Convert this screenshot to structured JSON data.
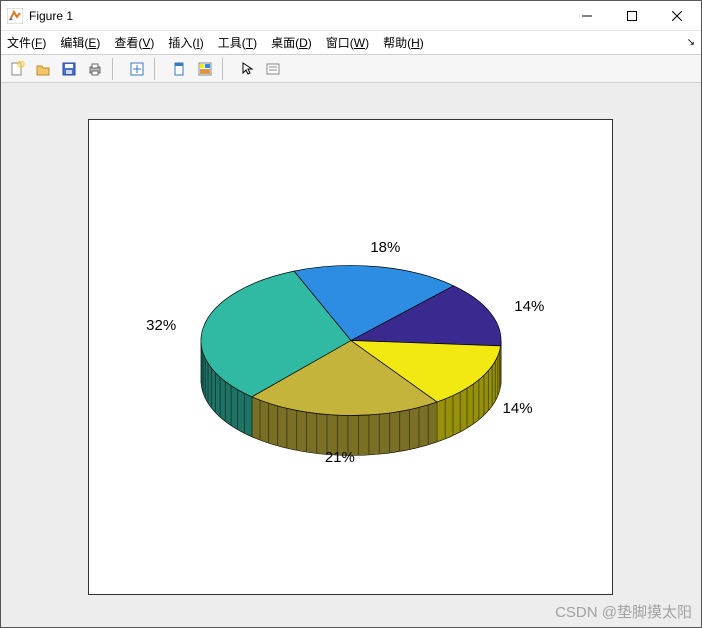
{
  "window": {
    "title": "Figure 1",
    "minimize": "−",
    "maximize": "□",
    "close": "×"
  },
  "menu": {
    "file": "文件(F)",
    "edit": "编辑(E)",
    "view": "查看(V)",
    "insert": "插入(I)",
    "tools": "工具(T)",
    "desktop": "桌面(D)",
    "window": "窗口(W)",
    "help": "帮助(H)"
  },
  "toolbar": {
    "new": "new",
    "open": "open",
    "save": "save",
    "print": "print",
    "link": "link",
    "datacursor": "datacursor",
    "colorbar": "colorbar",
    "pointer": "pointer",
    "legend": "legend"
  },
  "chart_data": {
    "type": "pie",
    "title": "",
    "slices": [
      {
        "label": "21%",
        "value": 21,
        "color": "#c4b43b"
      },
      {
        "label": "32%",
        "value": 32,
        "color": "#30baa3"
      },
      {
        "label": "18%",
        "value": 18,
        "color": "#2c8de3"
      },
      {
        "label": "14%",
        "value": 14,
        "color": "#3a2a8f"
      },
      {
        "label": "14%",
        "value": 14,
        "color": "#f2e812"
      }
    ],
    "style": "3d"
  },
  "watermark": "CSDN @垫脚摸太阳"
}
